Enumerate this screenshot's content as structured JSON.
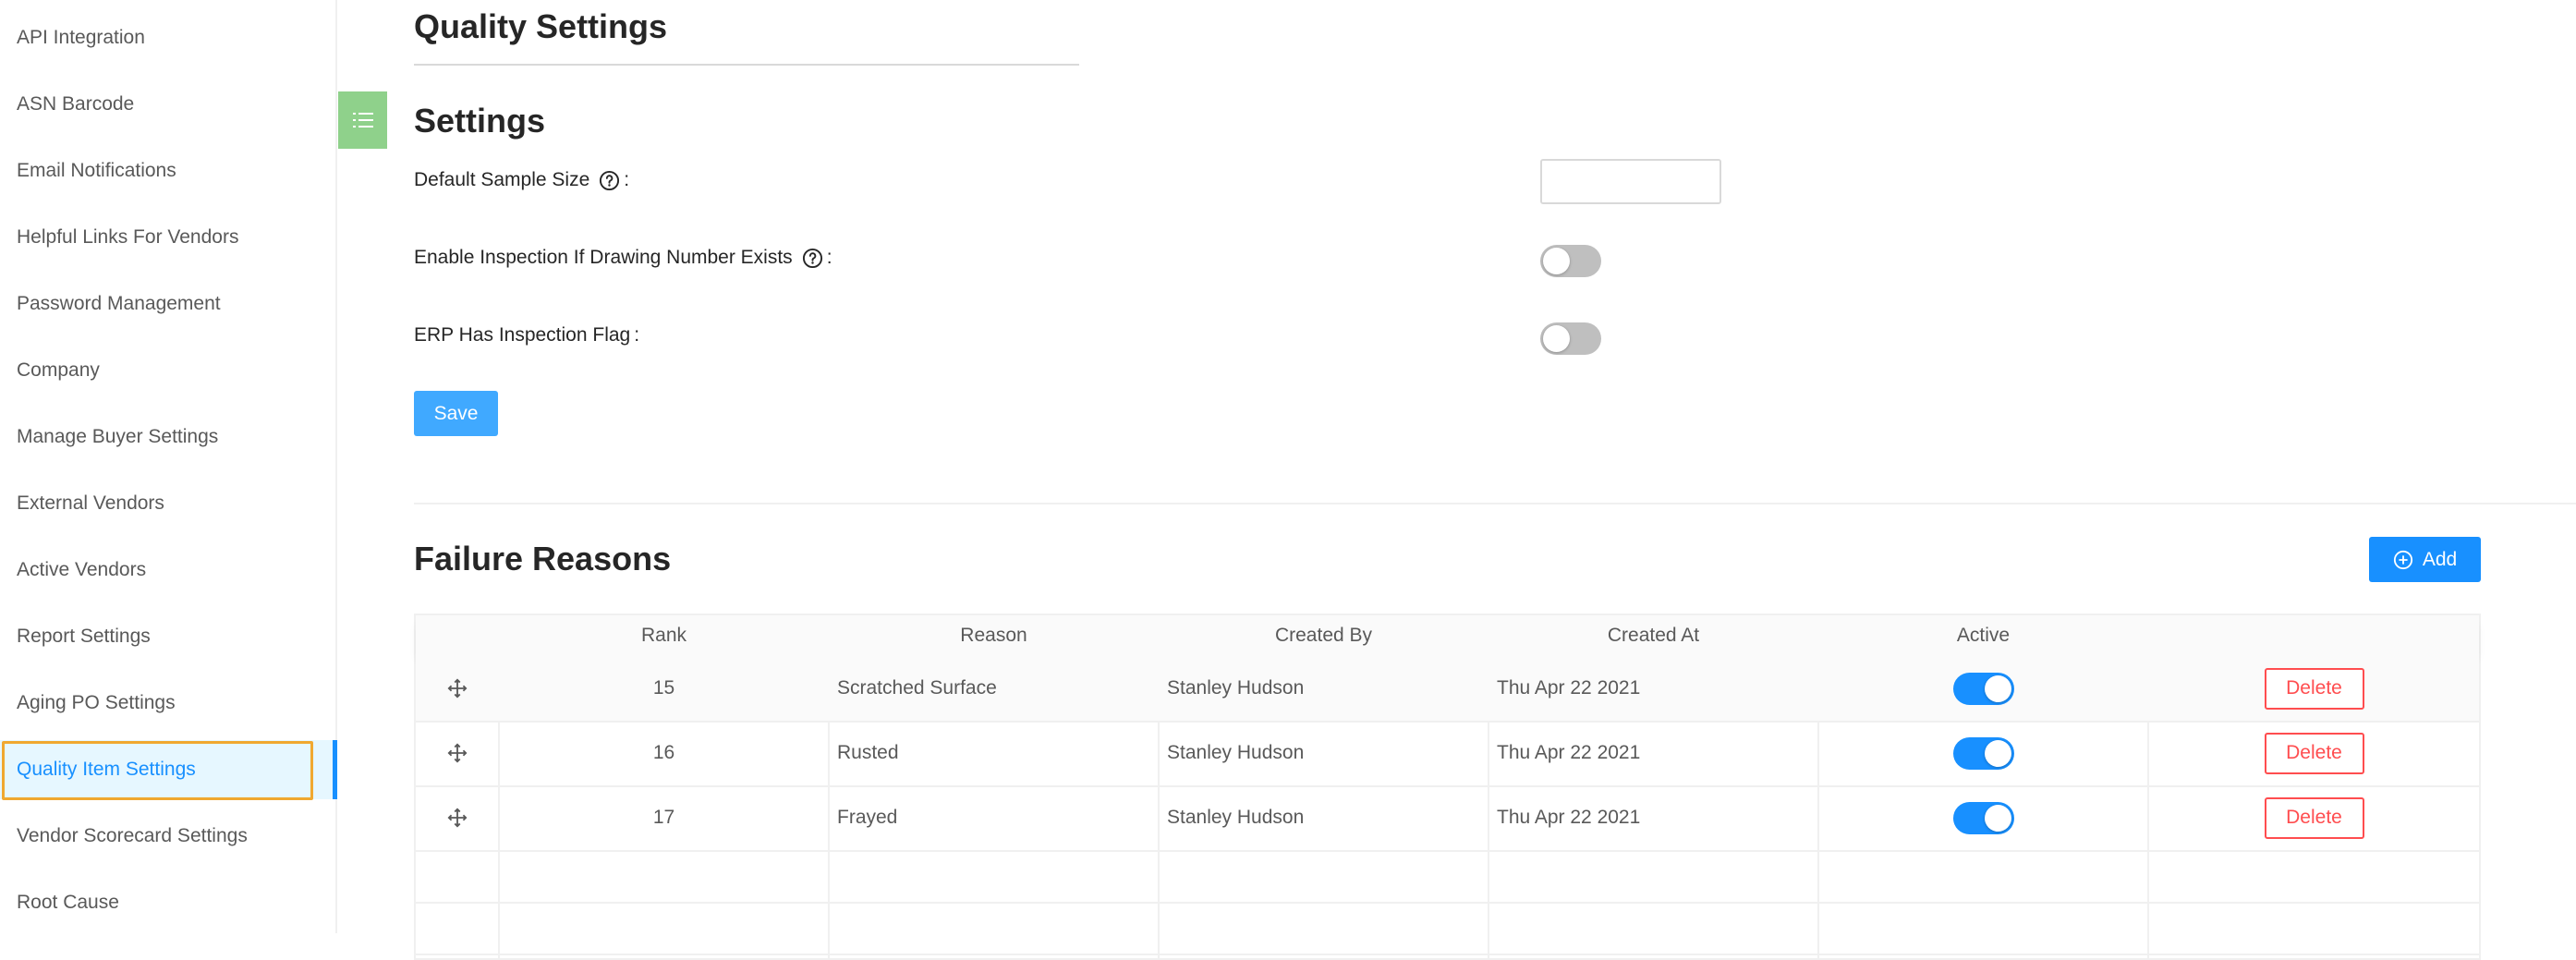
{
  "sidebar": {
    "items": [
      {
        "label": "API Integration"
      },
      {
        "label": "ASN Barcode"
      },
      {
        "label": "Email Notifications"
      },
      {
        "label": "Helpful Links For Vendors"
      },
      {
        "label": "Password Management"
      },
      {
        "label": "Company"
      },
      {
        "label": "Manage Buyer Settings"
      },
      {
        "label": "External Vendors"
      },
      {
        "label": "Active Vendors"
      },
      {
        "label": "Report Settings"
      },
      {
        "label": "Aging PO Settings"
      },
      {
        "label": "Quality Item Settings"
      },
      {
        "label": "Vendor Scorecard Settings"
      },
      {
        "label": "Root Cause"
      }
    ],
    "active_item": "Quality Item Settings"
  },
  "header": {
    "title": "Quality Settings"
  },
  "settings": {
    "title": "Settings",
    "default_sample_size": {
      "label": "Default Sample Size",
      "value": ""
    },
    "enable_inspection": {
      "label": "Enable Inspection If Drawing Number Exists",
      "enabled": false
    },
    "erp_flag": {
      "label": "ERP Has Inspection Flag",
      "enabled": false
    },
    "colon": ":",
    "save_label": "Save"
  },
  "failure_reasons": {
    "title": "Failure Reasons",
    "add_label": "Add",
    "columns": [
      "",
      "Rank",
      "Reason",
      "Created By",
      "Created At",
      "Active",
      ""
    ],
    "rows": [
      {
        "rank": "15",
        "reason": "Scratched Surface",
        "created_by": "Stanley Hudson",
        "created_at": "Thu Apr 22 2021",
        "active": true,
        "action": "Delete"
      },
      {
        "rank": "16",
        "reason": "Rusted",
        "created_by": "Stanley Hudson",
        "created_at": "Thu Apr 22 2021",
        "active": true,
        "action": "Delete"
      },
      {
        "rank": "17",
        "reason": "Frayed",
        "created_by": "Stanley Hudson",
        "created_at": "Thu Apr 22 2021",
        "active": true,
        "action": "Delete"
      }
    ]
  },
  "colors": {
    "accent": "#1890ff",
    "danger": "#ff4d4f",
    "highlight": "#f0a830",
    "toggle": "#8fd18b"
  },
  "icons": {
    "menu_toggle": "list-icon",
    "help": "question-circle-icon",
    "drag": "drag-move-icon",
    "add": "plus-circle-icon"
  }
}
